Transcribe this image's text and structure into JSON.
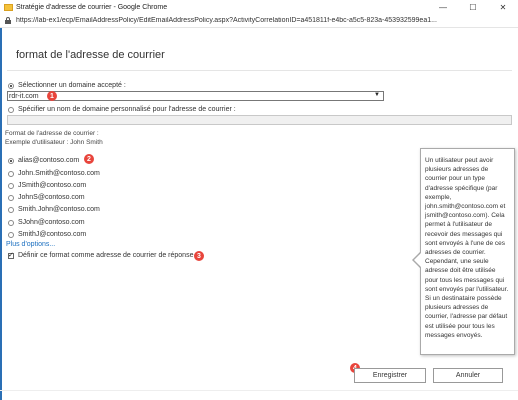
{
  "window": {
    "title": "Stratégie d'adresse de courrier - Google Chrome",
    "minimize": "—",
    "maximize": "☐",
    "close": "✕"
  },
  "address_bar": {
    "url": "https://lab-ex1/ecp/EmailAddressPolicy/EditEmailAddressPolicy.aspx?ActivityCorrelationID=a451811f-e4bc-a5c5-823a-453932599ea1..."
  },
  "page": {
    "title": "format de l'adresse de courrier"
  },
  "domain": {
    "accepted_label": "Sélectionner un domaine accepté :",
    "selected_value": "rdr-it.com",
    "dropdown_arrow": "▼",
    "custom_label": "Spécifier un nom de domaine personnalisé pour l'adresse de courrier :"
  },
  "format": {
    "heading": "Format de l'adresse de courrier :",
    "example": "Exemple d'utilisateur : John Smith",
    "options": [
      "alias@contoso.com",
      "John.Smith@contoso.com",
      "JSmith@contoso.com",
      "JohnS@contoso.com",
      "Smith.John@contoso.com",
      "SJohn@contoso.com",
      "SmithJ@contoso.com"
    ],
    "more_options": "Plus d'options...",
    "reply_checkbox": "Définir ce format comme adresse de courrier de réponse"
  },
  "tooltip": {
    "text": "Un utilisateur peut avoir plusieurs adresses de courrier pour un type d'adresse spécifique (par exemple, john.smith@contoso.com et jsmith@contoso.com). Cela permet à l'utilisateur de recevoir des messages qui sont envoyés à l'une de ces adresses de courrier. Cependant, une seule adresse doit être utilisée pour tous les messages qui sont envoyés par l'utilisateur. Si un destinataire possède plusieurs adresses de courrier, l'adresse par défaut est utilisée pour tous les messages envoyés."
  },
  "buttons": {
    "save": "Enregistrer",
    "cancel": "Annuler"
  },
  "badges": [
    "1",
    "2",
    "3",
    "4"
  ],
  "colors": {
    "badge": "#e8453c",
    "link": "#1a6fc0",
    "accent_strip": "#2a6fb5"
  }
}
